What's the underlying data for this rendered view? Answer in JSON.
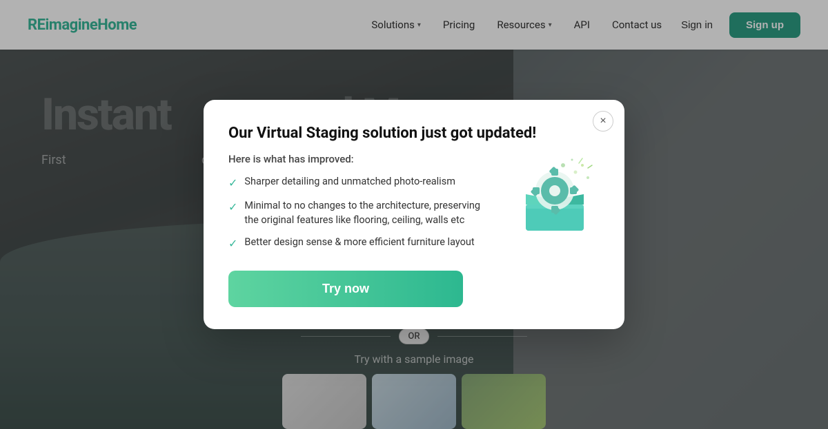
{
  "navbar": {
    "logo_text_re": "RE",
    "logo_text_imagine": "ima",
    "logo_text_g": "g",
    "logo_text_ine": "ine",
    "logo_full": "REimag",
    "logo_display": "REimagineHome",
    "nav_items": [
      {
        "id": "solutions",
        "label": "Solutions",
        "has_chevron": true
      },
      {
        "id": "pricing",
        "label": "Pricing",
        "has_chevron": false
      },
      {
        "id": "resources",
        "label": "Resources",
        "has_chevron": true
      },
      {
        "id": "api",
        "label": "API",
        "has_chevron": false
      },
      {
        "id": "contact",
        "label": "Contact us",
        "has_chevron": false
      }
    ],
    "signin_label": "Sign in",
    "signup_label": "Sign up"
  },
  "hero": {
    "headline": "Instant                    nd More",
    "sub": "First                                                   ow!"
  },
  "or_label": "OR",
  "sample_label": "Try with a sample image",
  "modal": {
    "title": "Our Virtual Staging solution just got updated!",
    "subtitle": "Here is what has improved:",
    "items": [
      "Sharper detailing and unmatched photo-realism",
      "Minimal to no changes to the architecture, preserving the original features like flooring, ceiling, walls etc",
      "Better design sense & more efficient furniture layout"
    ],
    "cta_label": "Try now",
    "close_label": "×"
  },
  "colors": {
    "accent": "#2d9e85",
    "accent_gradient_start": "#5ed4a0",
    "accent_gradient_end": "#2db890",
    "gear_teal": "#5abcaa",
    "gear_box": "#5ec8b0",
    "gear_dots": "#5abcaa"
  }
}
